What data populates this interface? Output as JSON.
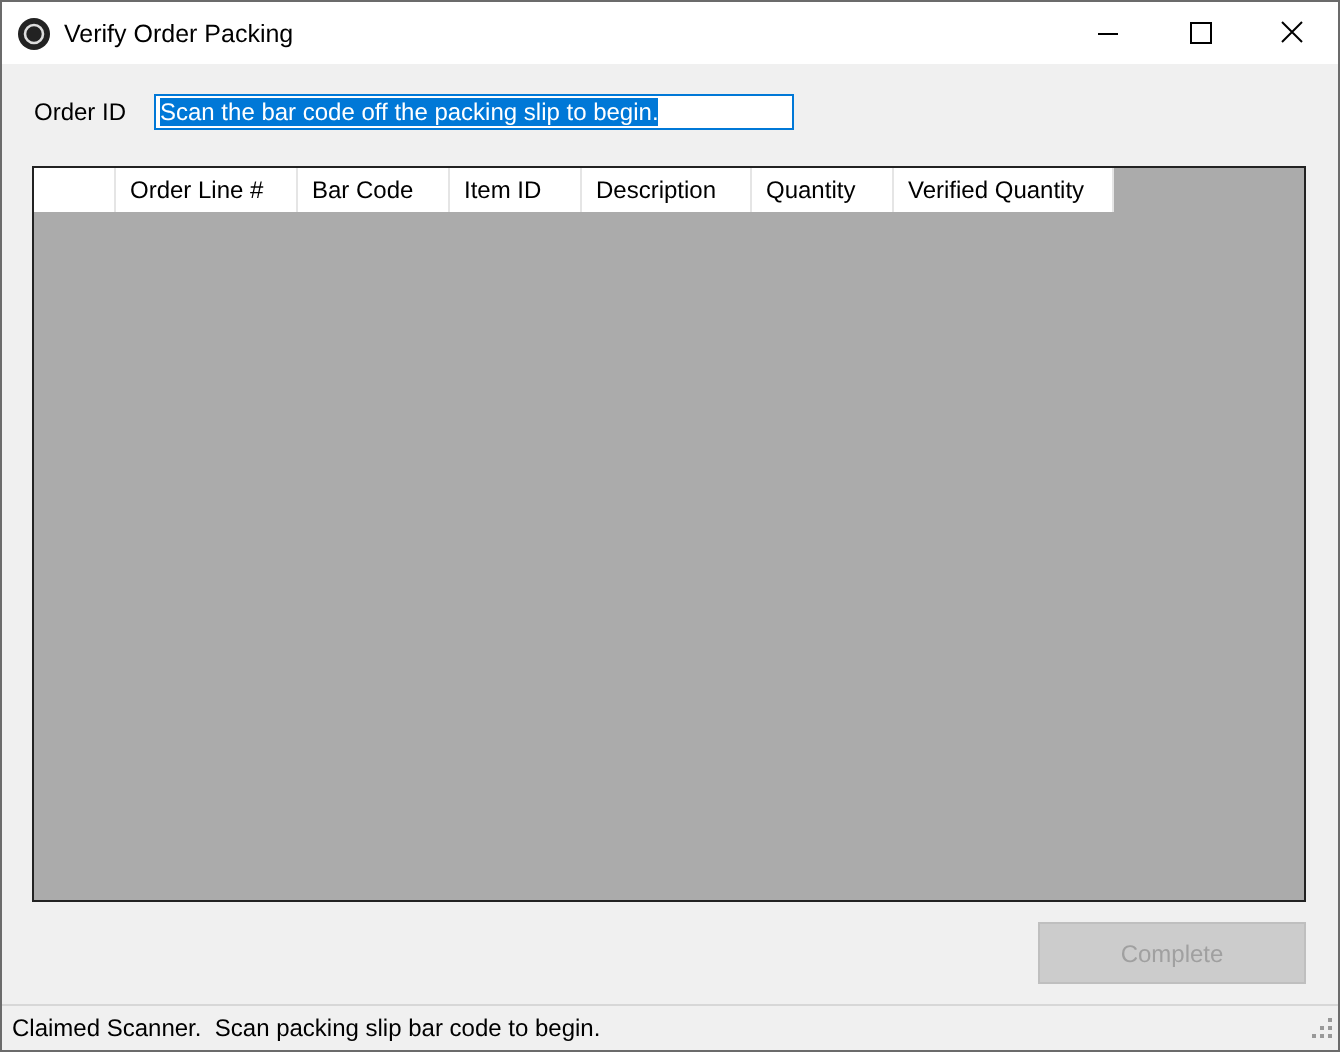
{
  "window": {
    "title": "Verify Order Packing"
  },
  "order_field": {
    "label": "Order ID",
    "value": "Scan the bar code off the packing slip to begin.",
    "text_selected": true
  },
  "table": {
    "columns": [
      {
        "label": "Order Line #"
      },
      {
        "label": "Bar Code"
      },
      {
        "label": "Item ID"
      },
      {
        "label": "Description"
      },
      {
        "label": "Quantity"
      },
      {
        "label": "Verified Quantity"
      }
    ]
  },
  "complete_button": {
    "label": "Complete",
    "disabled": true
  },
  "status_bar": {
    "text": "Claimed Scanner.  Scan packing slip bar code to begin."
  }
}
